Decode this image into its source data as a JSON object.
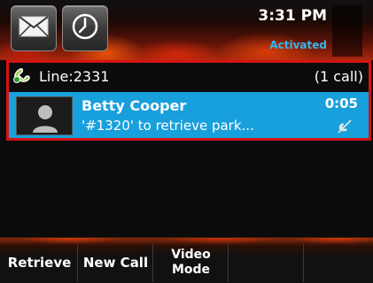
{
  "status_bar": {
    "time": "3:31 PM",
    "registration_status": "Activated",
    "icons": [
      "envelope-icon",
      "clock-icon"
    ]
  },
  "line": {
    "label": "Line:2331",
    "call_count": "(1 call)",
    "icon": "handset-icon"
  },
  "call": {
    "caller_name": "Betty Cooper",
    "timer": "0:05",
    "subtext": "'#1320' to retrieve park...",
    "icons": [
      "avatar-icon",
      "mute-icon"
    ]
  },
  "softkeys": {
    "retrieve": "Retrieve",
    "new_call": "New Call",
    "video_mode": "Video\nMode"
  },
  "colors": {
    "accent_blue": "#18a0dc",
    "highlight_red": "#d41414",
    "status_text": "#2fb8f0"
  }
}
